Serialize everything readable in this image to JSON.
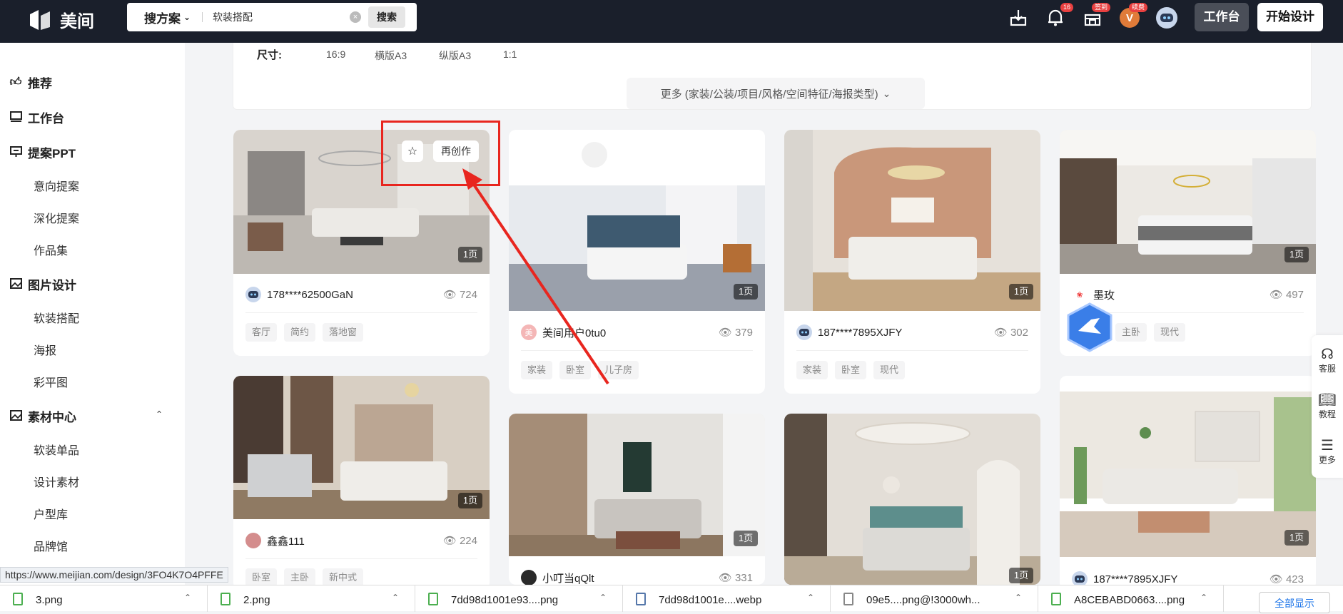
{
  "header": {
    "logo_text": "美间",
    "search_type": "搜方案",
    "search_value": "软装搭配",
    "search_button": "搜索",
    "notification_badge": "16",
    "shop_badge": "签到",
    "vip_badge": "续费",
    "vip_letter": "V",
    "workbench_button": "工作台",
    "start_design_button": "开始设计"
  },
  "sidebar": {
    "recommend": "推荐",
    "workbench": "工作台",
    "ppt": "提案PPT",
    "ppt_items": [
      "意向提案",
      "深化提案",
      "作品集"
    ],
    "image_design": "图片设计",
    "image_items": [
      "软装搭配",
      "海报",
      "彩平图"
    ],
    "material": "素材中心",
    "material_items": [
      "软装单品",
      "设计素材",
      "户型库",
      "品牌馆"
    ]
  },
  "filter": {
    "size_label": "尺寸:",
    "size_options": [
      "16:9",
      "横版A3",
      "纵版A3",
      "1:1"
    ],
    "more_label": "更多 (家装/公装/项目/风格/空间特征/海报类型)"
  },
  "hover": {
    "remake_label": "再创作"
  },
  "cards": [
    {
      "pages": "1页",
      "author": "178****62500GaN",
      "views": "724",
      "tags": [
        "客厅",
        "简约",
        "落地窗"
      ]
    },
    {
      "pages": "1页",
      "author": "美间用户0tu0",
      "avatar_char": "美",
      "views": "379",
      "tags": [
        "家装",
        "卧室",
        "儿子房"
      ]
    },
    {
      "pages": "1页",
      "author": "187****7895XJFY",
      "views": "302",
      "tags": [
        "家装",
        "卧室",
        "现代"
      ]
    },
    {
      "pages": "1页",
      "author": "墨玫",
      "views": "497",
      "tags": [
        "主卧",
        "现代"
      ]
    },
    {
      "pages": "1页",
      "author": "鑫鑫111",
      "views": "224",
      "tags": [
        "卧室",
        "主卧",
        "新中式"
      ]
    },
    {
      "pages": "1页",
      "author": "小叮当qQlt",
      "views": "331",
      "tags": []
    },
    {
      "pages": "1页",
      "author": "",
      "views": "",
      "tags": []
    },
    {
      "pages": "1页",
      "author": "187****7895XJFY",
      "views": "423",
      "tags": []
    }
  ],
  "rightbar": {
    "service": "客服",
    "tutorial": "教程",
    "more": "更多"
  },
  "status_url": "https://www.meijian.com/design/3FO4K7O4PFFE",
  "downloads": [
    {
      "name": "3.png"
    },
    {
      "name": "2.png"
    },
    {
      "name": "7dd98d1001e93....png"
    },
    {
      "name": "7dd98d1001e....webp"
    },
    {
      "name": "09e5....png@!3000wh..."
    },
    {
      "name": "A8CEBABD0663....png"
    }
  ],
  "show_all": "全部显示",
  "colors": {
    "topbar": "#1a1f2b",
    "annotation_red": "#e8261f"
  }
}
